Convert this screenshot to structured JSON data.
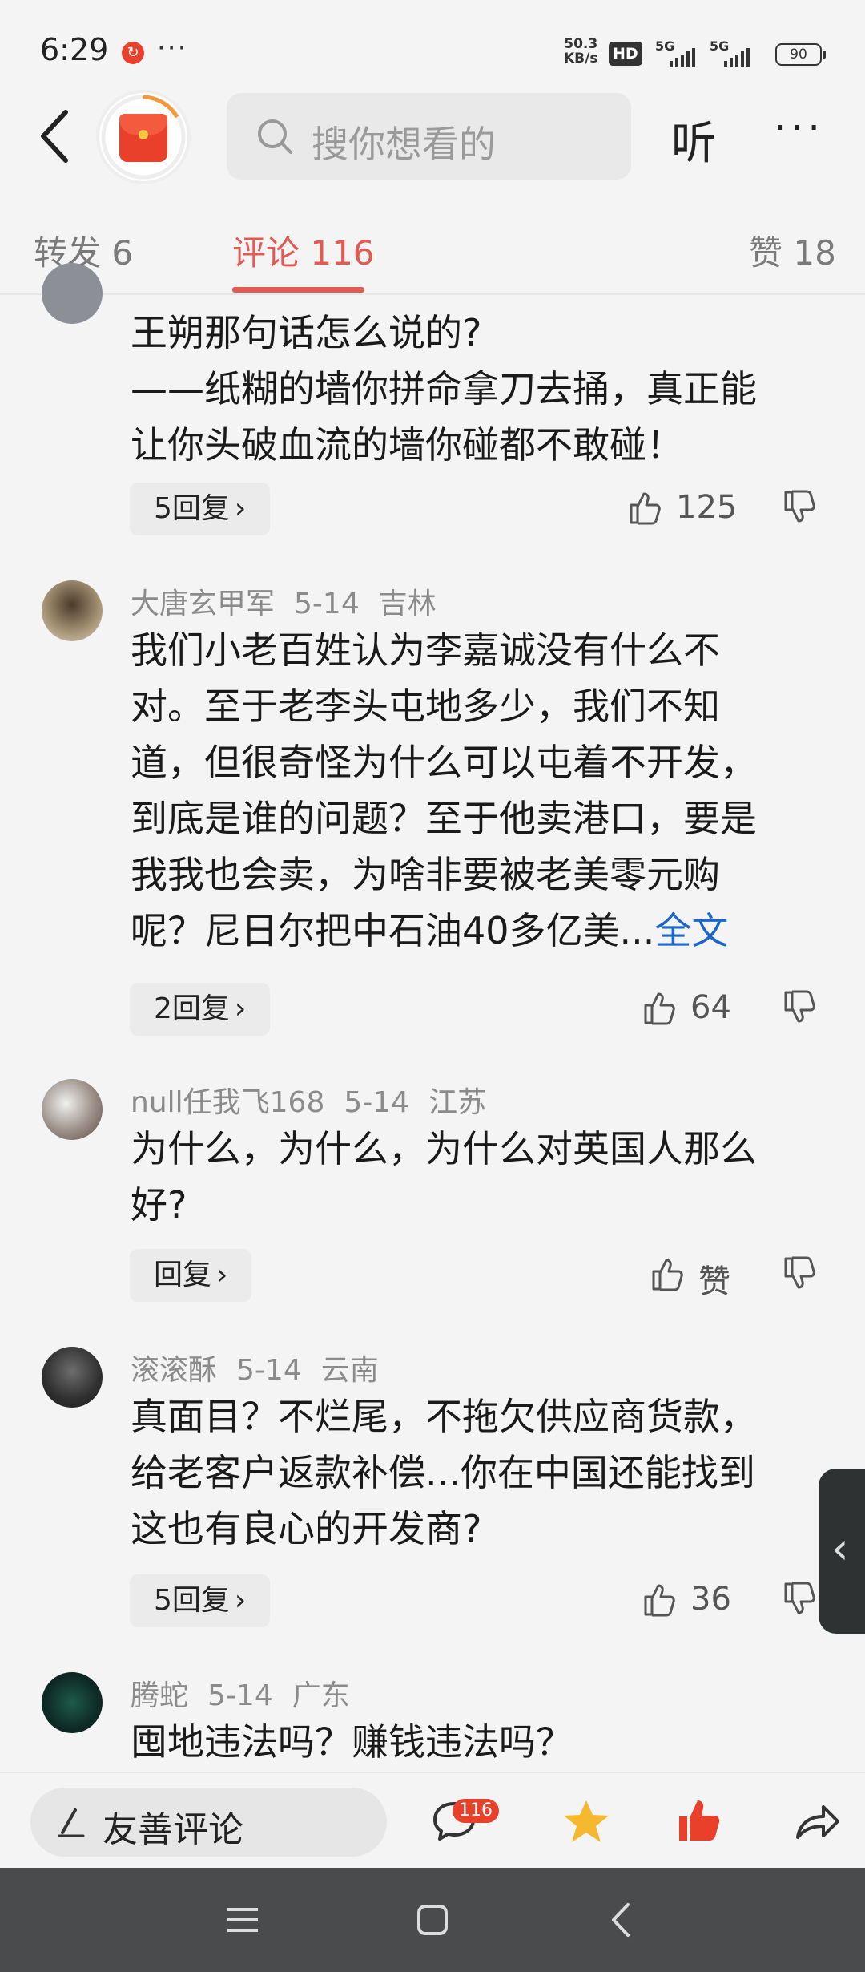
{
  "status": {
    "time": "6:29",
    "more": "···",
    "net_speed_top": "50.3",
    "net_speed_bottom": "KB/s",
    "hd": "HD",
    "sig1": "5G",
    "sig2": "5G",
    "battery": "90"
  },
  "header": {
    "search_placeholder": "搜你想看的",
    "listen_label": "听",
    "more_label": "···"
  },
  "tabs": [
    {
      "label": "转发 6"
    },
    {
      "label": "评论 116"
    },
    {
      "label": "赞 18"
    }
  ],
  "comments": [
    {
      "user": "",
      "date": "",
      "location": "",
      "lines": [
        "王朔那句话怎么说的?",
        "——纸糊的墙你拼命拿刀去捅，真正能",
        "让你头破血流的墙你碰都不敢碰！"
      ],
      "reply_label": "5回复",
      "likes": "125"
    },
    {
      "user": "大唐玄甲军",
      "date": "5-14",
      "location": "吉林",
      "lines": [
        "我们小老百姓认为李嘉诚没有什么不",
        "对。至于老李头屯地多少，我们不知",
        "道，但很奇怪为什么可以屯着不开发，",
        "到底是谁的问题？至于他卖港口，要是",
        "我我也会卖，为啥非要被老美零元购",
        "呢？尼日尔把中石油40多亿美..."
      ],
      "full_text_label": "全文",
      "reply_label": "2回复",
      "likes": "64"
    },
    {
      "user": "null任我飞168",
      "date": "5-14",
      "location": "江苏",
      "lines": [
        "为什么，为什么，为什么对英国人那么",
        "好?"
      ],
      "reply_label": "回复",
      "likes": "赞"
    },
    {
      "user": "滚滚酥",
      "date": "5-14",
      "location": "云南",
      "lines": [
        "真面目？不烂尾，不拖欠供应商货款，",
        "给老客户返款补偿...你在中国还能找到",
        "这也有良心的开发商?"
      ],
      "reply_label": "5回复",
      "likes": "36"
    },
    {
      "user": "腾蛇",
      "date": "5-14",
      "location": "广东",
      "lines": [
        "囤地违法吗？赚钱违法吗？"
      ]
    }
  ],
  "bottom": {
    "comment_placeholder": "友善评论",
    "comment_count_badge": "116"
  },
  "colors": {
    "accent": "#e25b52",
    "link": "#1a66c9",
    "like_red": "#e8402b",
    "star": "#f5b82e"
  }
}
